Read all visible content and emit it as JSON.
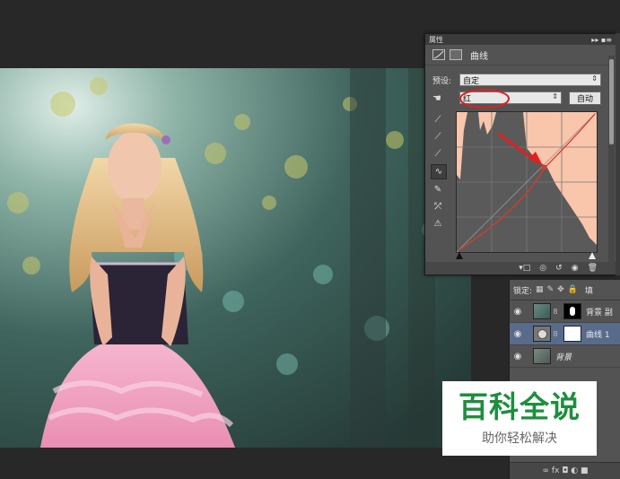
{
  "properties_panel": {
    "tab_label": "属性",
    "panel_menu_glyph": "▸▸ ▪≡",
    "title": "曲线",
    "preset_label": "预设:",
    "preset_value": "自定",
    "channel_value": "红",
    "auto_button": "自动",
    "annotation_color": "#e02020"
  },
  "layers_panel": {
    "lock_label": "锁定:",
    "fill_label": "填",
    "layers": [
      {
        "name": "背景 副",
        "type": "raster-with-mask"
      },
      {
        "name": "曲线 1",
        "type": "curves-adjustment",
        "active": true
      },
      {
        "name": "背景",
        "type": "background"
      }
    ],
    "footer_icons": "∞ fx ◘ ◐ ■"
  },
  "watermark": {
    "title": "百科全说",
    "subtitle": "助你轻松解决",
    "title_color": "#1e8e3e"
  }
}
